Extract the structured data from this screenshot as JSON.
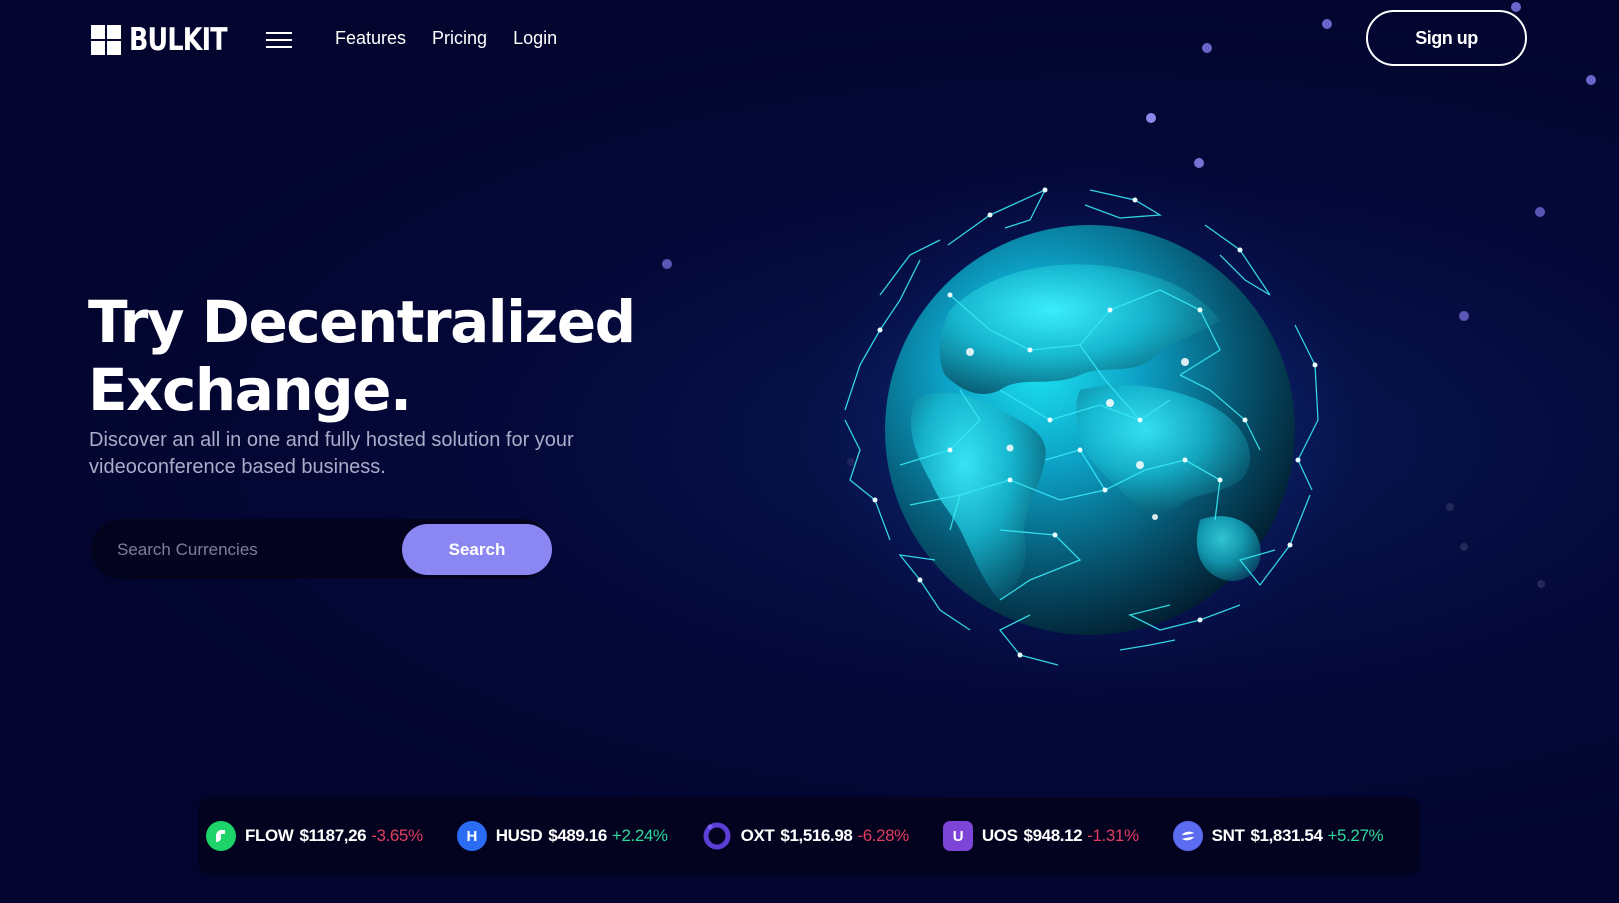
{
  "header": {
    "brand": "BULKIT",
    "nav": [
      {
        "label": "Features"
      },
      {
        "label": "Pricing"
      },
      {
        "label": "Login"
      }
    ],
    "signup_label": "Sign up"
  },
  "hero": {
    "title_line1": "Try Decentralized",
    "title_line2": "Exchange.",
    "subtitle": "Discover an all in one and fully hosted solution for your videoconference based business."
  },
  "search": {
    "placeholder": "Search Currencies",
    "value": "",
    "button_label": "Search"
  },
  "ticker": [
    {
      "symbol": "FLOW",
      "price": "$1187,26",
      "change": "-3.65%",
      "direction": "down",
      "icon": "flow-coin-icon",
      "color": "#1fd36b"
    },
    {
      "symbol": "HUSD",
      "price": "$489.16",
      "change": "+2.24%",
      "direction": "up",
      "icon": "husd-coin-icon",
      "color": "#2a6df4"
    },
    {
      "symbol": "OXT",
      "price": "$1,516.98",
      "change": "-6.28%",
      "direction": "down",
      "icon": "oxt-coin-icon",
      "color": "#5b3fd6"
    },
    {
      "symbol": "UOS",
      "price": "$948.12",
      "change": "-1.31%",
      "direction": "down",
      "icon": "uos-coin-icon",
      "color": "#7c45d8"
    },
    {
      "symbol": "SNT",
      "price": "$1,831.54",
      "change": "+5.27%",
      "direction": "up",
      "icon": "snt-coin-icon",
      "color": "#5b6cf0"
    }
  ],
  "colors": {
    "background": "#050530",
    "accent": "#8a86f2",
    "negative": "#e23d5f",
    "positive": "#2fd99a",
    "globe": "#1ad6e6"
  }
}
